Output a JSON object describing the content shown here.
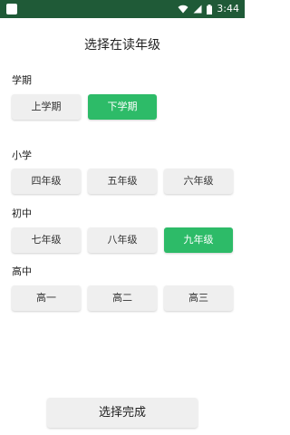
{
  "status_bar": {
    "time": "3:44",
    "icons": [
      "app-icon",
      "wifi-icon",
      "signal-icon",
      "battery-icon"
    ]
  },
  "title": "选择在读年级",
  "semester": {
    "label": "学期",
    "options": [
      {
        "label": "上学期",
        "selected": false
      },
      {
        "label": "下学期",
        "selected": true
      }
    ]
  },
  "primary": {
    "label": "小学",
    "options": [
      {
        "label": "四年级",
        "selected": false
      },
      {
        "label": "五年级",
        "selected": false
      },
      {
        "label": "六年级",
        "selected": false
      }
    ]
  },
  "junior": {
    "label": "初中",
    "options": [
      {
        "label": "七年级",
        "selected": false
      },
      {
        "label": "八年级",
        "selected": false
      },
      {
        "label": "九年级",
        "selected": true
      }
    ]
  },
  "senior": {
    "label": "高中",
    "options": [
      {
        "label": "高一",
        "selected": false
      },
      {
        "label": "高二",
        "selected": false
      },
      {
        "label": "高三",
        "selected": false
      }
    ]
  },
  "done_label": "选择完成",
  "colors": {
    "status_bar": "#1f5a37",
    "accent": "#2dbb68",
    "button_bg": "#efefef"
  }
}
